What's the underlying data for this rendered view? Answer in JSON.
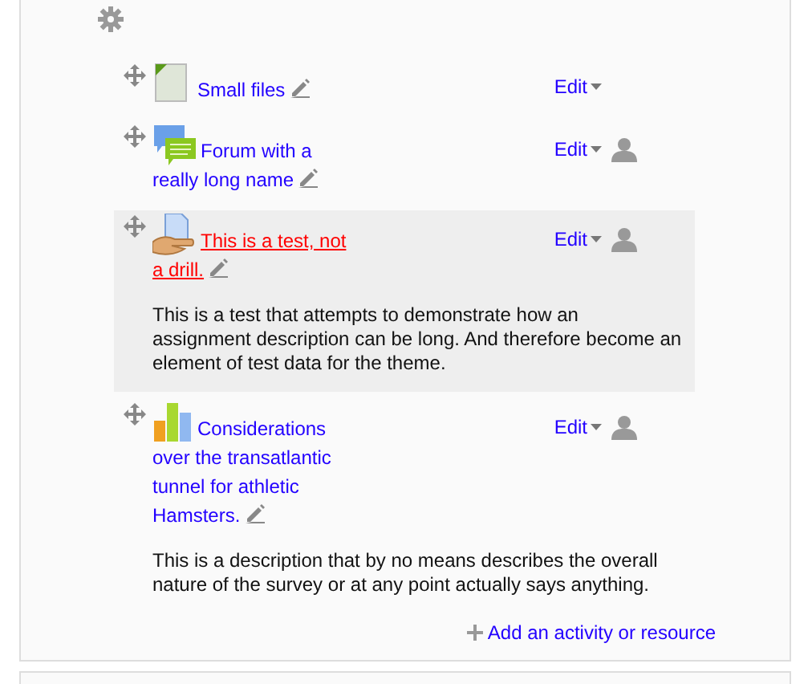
{
  "activities": [
    {
      "kind": "file",
      "title": "Small files",
      "edit": "Edit",
      "highlighted": false,
      "group_icon": false
    },
    {
      "kind": "forum",
      "title": "Forum with a really long name",
      "edit": "Edit",
      "highlighted": false,
      "group_icon": true
    },
    {
      "kind": "assignment",
      "title": "This is a test, not a drill.",
      "edit": "Edit",
      "highlighted": true,
      "group_icon": true,
      "description": "This is a test that attempts to demonstrate how an assignment description can be long. And therefore become an element of test data for the theme."
    },
    {
      "kind": "survey",
      "title": "Considerations over the transatlantic tunnel for athletic Hamsters.",
      "edit": "Edit",
      "highlighted": false,
      "group_icon": true,
      "description": "This is a description that by no means describes the overall nature of the survey or at any point actually says anything."
    }
  ],
  "add_link": "Add an activity or resource"
}
